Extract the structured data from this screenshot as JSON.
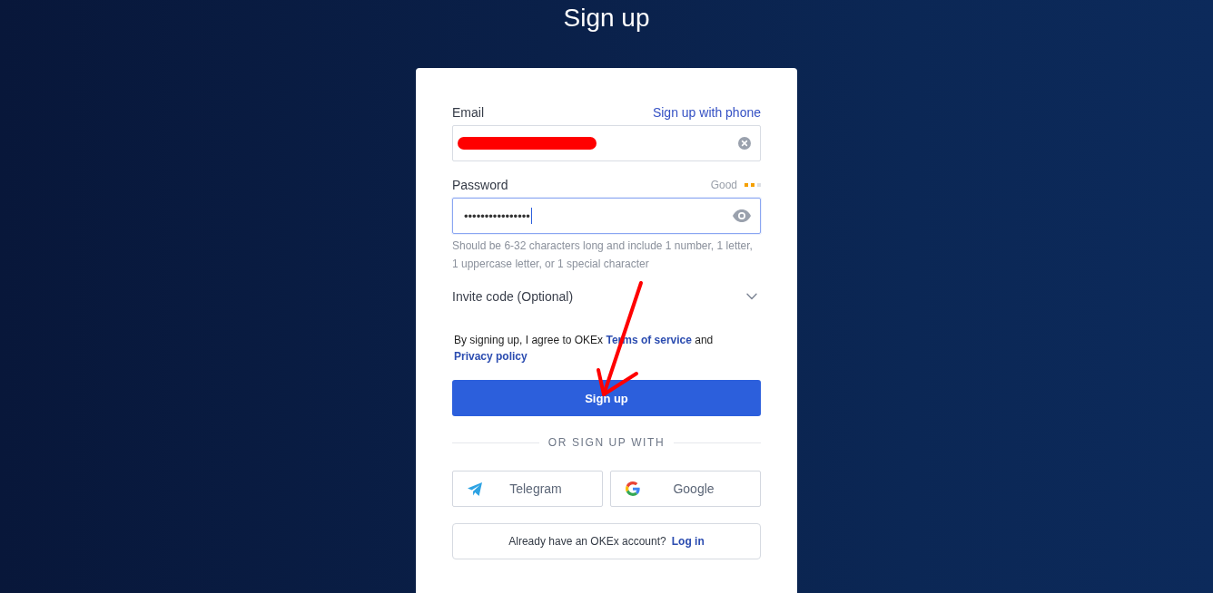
{
  "page": {
    "title": "Sign up"
  },
  "email": {
    "label": "Email",
    "alt_link": "Sign up with phone",
    "value_redacted": true
  },
  "password": {
    "label": "Password",
    "strength": {
      "label": "Good",
      "level": 0.67
    },
    "value": "••••••••••••••••",
    "focused": true,
    "hint": "Should be 6-32 characters long and include 1 number, 1 letter, 1 uppercase letter, or 1 special character"
  },
  "invite_code": {
    "label": "Invite code (Optional)",
    "expanded": false
  },
  "agreement": [
    {
      "kind": "text",
      "text": "By signing up, I agree to OKEx "
    },
    {
      "kind": "link",
      "text": "Terms of service"
    },
    {
      "kind": "text",
      "text": " and "
    },
    {
      "kind": "link",
      "text": "Privacy policy"
    }
  ],
  "submit_button": "Sign up",
  "divider": "OR SIGN UP WITH",
  "social_buttons": [
    {
      "kind": "telegram",
      "label": "Telegram"
    },
    {
      "kind": "google",
      "label": "Google"
    }
  ],
  "login_prompt": {
    "text": "Already have an OKEx account?",
    "link": "Log in"
  },
  "annotation_arrow": true
}
